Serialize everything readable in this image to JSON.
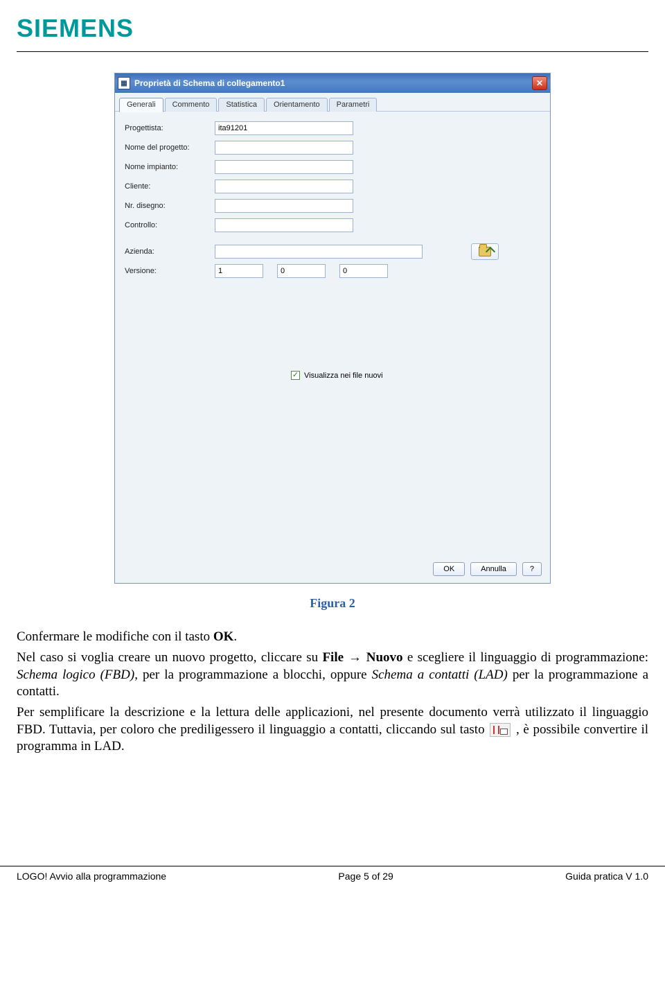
{
  "brand": "SIEMENS",
  "dialog": {
    "title": "Proprietà di Schema di collegamento1",
    "tabs": [
      "Generali",
      "Commento",
      "Statistica",
      "Orientamento",
      "Parametri"
    ],
    "activeTab": 0,
    "fields": {
      "progettista_label": "Progettista:",
      "progettista_value": "ita91201",
      "nome_progetto_label": "Nome del progetto:",
      "nome_progetto_value": "",
      "nome_impianto_label": "Nome impianto:",
      "nome_impianto_value": "",
      "cliente_label": "Cliente:",
      "cliente_value": "",
      "nr_disegno_label": "Nr. disegno:",
      "nr_disegno_value": "",
      "controllo_label": "Controllo:",
      "controllo_value": "",
      "azienda_label": "Azienda:",
      "azienda_value": "",
      "versione_label": "Versione:",
      "versione_1": "1",
      "versione_2": "0",
      "versione_3": "0"
    },
    "checkbox_label": "Visualizza nei file nuovi",
    "checkbox_checked": true,
    "buttons": {
      "ok": "OK",
      "cancel": "Annulla",
      "help": "?"
    }
  },
  "caption": "Figura 2",
  "para1_a": "Confermare le modifiche con il tasto ",
  "para1_b": "OK",
  "para1_c": ".",
  "para2_a": "Nel caso si voglia creare un nuovo progetto, cliccare su ",
  "para2_b": "File",
  "para2_arrow": " → ",
  "para2_c": "Nuovo",
  "para2_d": " e scegliere il linguaggio di programmazione: ",
  "para2_e": "Schema logico (FBD)",
  "para2_f": ", per la programmazione a blocchi, oppure ",
  "para2_g": "Schema a contatti (LAD)",
  "para2_h": " per la programmazione a contatti.",
  "para3_a": "Per semplificare la descrizione e la lettura delle applicazioni, nel presente documento verrà utilizzato il linguaggio FBD. Tuttavia, per coloro che prediligessero il linguaggio a contatti, cliccando sul tasto ",
  "para3_b": " , è possibile convertire il programma in LAD.",
  "footer": {
    "left": "LOGO! Avvio alla programmazione",
    "center": "Page 5 of 29",
    "right": "Guida pratica V 1.0"
  }
}
